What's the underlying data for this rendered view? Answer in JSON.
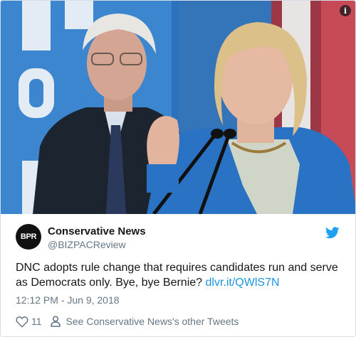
{
  "media": {
    "description_colors": {
      "sky": "#2b6fb8",
      "stage_sign": "#e7eef6",
      "jacket": "#2a73c4",
      "suit": "#1c2430",
      "stripe": "#b83040"
    },
    "info_label": "i"
  },
  "author": {
    "avatar_text": "BPR",
    "display_name": "Conservative News",
    "handle": "@BIZPACReview"
  },
  "tweet": {
    "text": "DNC adopts rule change that requires candidates run and serve as Democrats only. Bye, bye Bernie? ",
    "link_text": "dlvr.it/QWlS7N",
    "timestamp": "12:12 PM - Jun 9, 2018"
  },
  "actions": {
    "like_count": "11",
    "other_tweets_label": "See Conservative News's other Tweets"
  },
  "icons": {
    "brand": "twitter-bird-icon",
    "like": "heart-icon",
    "profile": "person-icon",
    "info": "info-icon"
  },
  "colors": {
    "link": "#1b95e0",
    "secondary_text": "#657786",
    "primary_text": "#14171a"
  }
}
